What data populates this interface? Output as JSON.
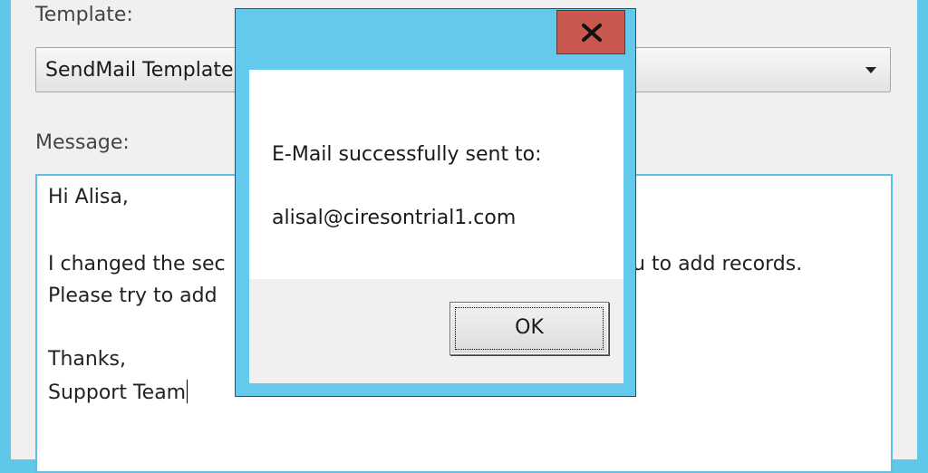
{
  "parent_window": {
    "template_label": "Template:",
    "template_value": "SendMail Template",
    "message_label": "Message:",
    "message_lines": [
      "Hi Alisa,",
      "",
      "I changed the sec",
      "Please try to add",
      "",
      "Thanks,",
      "Support Team"
    ],
    "message_partial_text": "ou to add records."
  },
  "dialog": {
    "close_label": "X",
    "heading": "E-Mail successfully sent to:",
    "email": "alisal@ciresontrial1.com",
    "ok_label": "OK"
  },
  "colors": {
    "window_frame": "#5fc8e8",
    "dialog_frame": "#64c9ea",
    "close_button": "#c9594f",
    "input_border": "#5fbfe6"
  },
  "icons": {
    "combo_arrow": "chevron-down-icon",
    "close": "close-icon"
  }
}
